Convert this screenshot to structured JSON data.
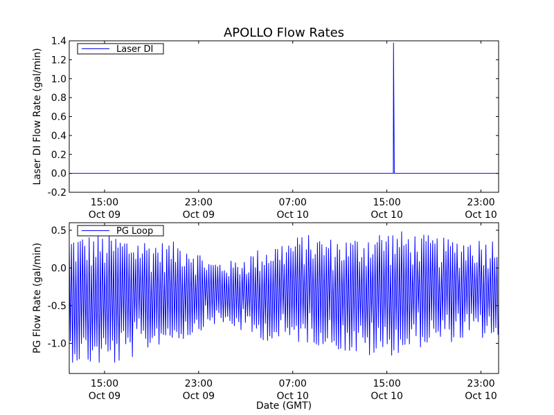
{
  "figure": {
    "title": "APOLLO Flow Rates",
    "xlabel": "Date (GMT)"
  },
  "chart_data": [
    {
      "type": "line",
      "ylabel": "Laser DI Flow Rate (gal/min)",
      "ylim": [
        -0.2,
        1.4
      ],
      "yticks": [
        -0.2,
        0.0,
        0.2,
        0.4,
        0.6,
        0.8,
        1.0,
        1.2,
        1.4
      ],
      "ytick_labels": [
        "-0.2",
        "0.0",
        "0.2",
        "0.4",
        "0.6",
        "0.8",
        "1.0",
        "1.2",
        "1.4"
      ],
      "xlim": [
        "2009-10-09 12:00",
        "2009-10-11 00:30"
      ],
      "xticks": [
        {
          "time": "Oct 09 15:00",
          "line1": "15:00",
          "line2": "Oct 09"
        },
        {
          "time": "Oct 09 23:00",
          "line1": "23:00",
          "line2": "Oct 09"
        },
        {
          "time": "Oct 10 07:00",
          "line1": "07:00",
          "line2": "Oct 10"
        },
        {
          "time": "Oct 10 15:00",
          "line1": "15:00",
          "line2": "Oct 10"
        },
        {
          "time": "Oct 10 23:00",
          "line1": "23:00",
          "line2": "Oct 10"
        }
      ],
      "grid": false,
      "legend": "top-left",
      "series": [
        {
          "name": "Laser DI",
          "color": "#0000ff",
          "points": [
            [
              "2009-10-09 12:00",
              0.0
            ],
            [
              "2009-10-10 15:33",
              0.0
            ],
            [
              "2009-10-10 15:34",
              1.38
            ],
            [
              "2009-10-10 15:38",
              0.0
            ],
            [
              "2009-10-11 00:30",
              0.0
            ]
          ]
        }
      ]
    },
    {
      "type": "line",
      "ylabel": "PG Flow Rate (gal/min)",
      "ylim": [
        -1.4,
        0.6
      ],
      "yticks": [
        -1.0,
        -0.5,
        0.0,
        0.5
      ],
      "ytick_labels": [
        "-1.0",
        "-0.5",
        "0.0",
        "0.5"
      ],
      "xlim": [
        "2009-10-09 12:00",
        "2009-10-11 00:30"
      ],
      "xticks": [
        {
          "time": "Oct 09 15:00",
          "line1": "15:00",
          "line2": "Oct 09"
        },
        {
          "time": "Oct 09 23:00",
          "line1": "23:00",
          "line2": "Oct 09"
        },
        {
          "time": "Oct 10 07:00",
          "line1": "07:00",
          "line2": "Oct 10"
        },
        {
          "time": "Oct 10 15:00",
          "line1": "15:00",
          "line2": "Oct 10"
        },
        {
          "time": "Oct 10 23:00",
          "line1": "23:00",
          "line2": "Oct 10"
        }
      ],
      "grid": false,
      "legend": "top-left",
      "series": [
        {
          "name": "PG Loop",
          "color": "#0000ff",
          "envelope": {
            "time": [
              "2009-10-09 12:00",
              "2009-10-09 14:00",
              "2009-10-09 16:00",
              "2009-10-09 18:00",
              "2009-10-09 20:00",
              "2009-10-09 22:00",
              "2009-10-10 00:00",
              "2009-10-10 02:00",
              "2009-10-10 04:00",
              "2009-10-10 06:00",
              "2009-10-10 08:00",
              "2009-10-10 10:00",
              "2009-10-10 12:00",
              "2009-10-10 14:00",
              "2009-10-10 16:00",
              "2009-10-10 18:00",
              "2009-10-10 20:00",
              "2009-10-10 22:00",
              "2009-10-11 00:30"
            ],
            "max": [
              0.45,
              0.45,
              0.45,
              0.4,
              0.35,
              0.35,
              0.1,
              0.1,
              0.25,
              0.35,
              0.45,
              0.4,
              0.4,
              0.5,
              0.5,
              0.45,
              0.4,
              0.4,
              0.4
            ],
            "min": [
              -1.25,
              -1.3,
              -1.3,
              -1.15,
              -1.0,
              -0.95,
              -0.75,
              -0.8,
              -0.95,
              -1.0,
              -1.0,
              -1.05,
              -1.15,
              -1.2,
              -1.15,
              -1.05,
              -1.0,
              -0.95,
              -0.95
            ]
          }
        }
      ]
    }
  ]
}
